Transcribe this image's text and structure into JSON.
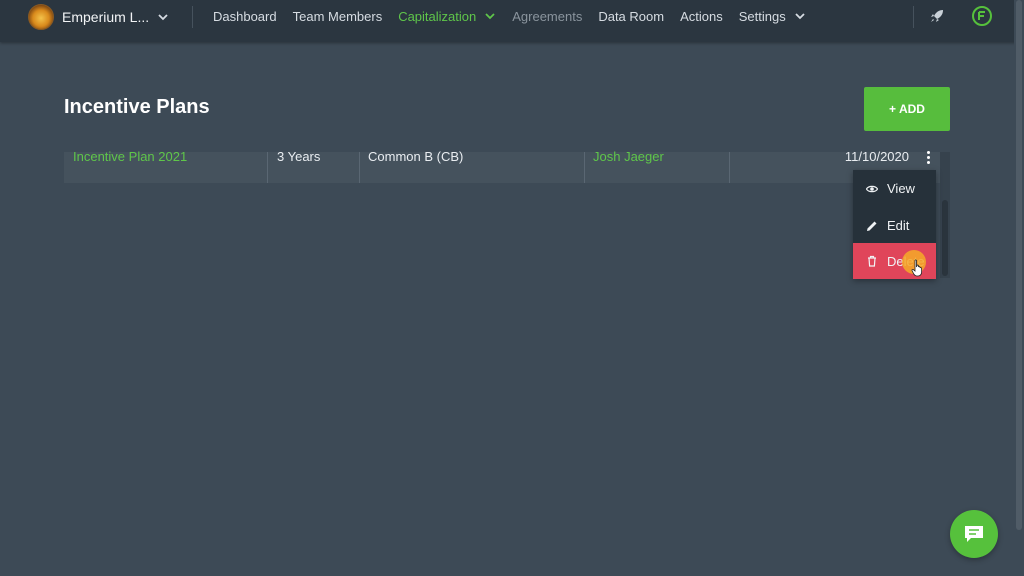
{
  "header": {
    "org_name": "Emperium L...",
    "nav": [
      {
        "label": "Dashboard"
      },
      {
        "label": "Team Members"
      },
      {
        "label": "Capitalization"
      },
      {
        "label": "Agreements"
      },
      {
        "label": "Data Room"
      },
      {
        "label": "Actions"
      },
      {
        "label": "Settings"
      }
    ],
    "rocket_icon": "rocket-icon",
    "brand_icon": "brand-logo-icon"
  },
  "page": {
    "title": "Incentive Plans",
    "add_label": "+ ADD"
  },
  "table": {
    "rows": [
      {
        "plan_name": "Incentive Plan 2021",
        "term": "3 Years",
        "share_class": "Common B (CB)",
        "owner": "Josh Jaeger",
        "date": "11/10/2020"
      }
    ]
  },
  "row_menu": {
    "items": [
      {
        "label": "View",
        "icon": "eye-icon"
      },
      {
        "label": "Edit",
        "icon": "pencil-icon"
      },
      {
        "label": "Delete",
        "icon": "trash-icon"
      }
    ]
  },
  "colors": {
    "accent_green": "#57bd3d",
    "danger": "#e0455a",
    "background": "#3d4a56",
    "topbar": "#2b3640"
  },
  "chat": {
    "icon": "chat-icon"
  }
}
